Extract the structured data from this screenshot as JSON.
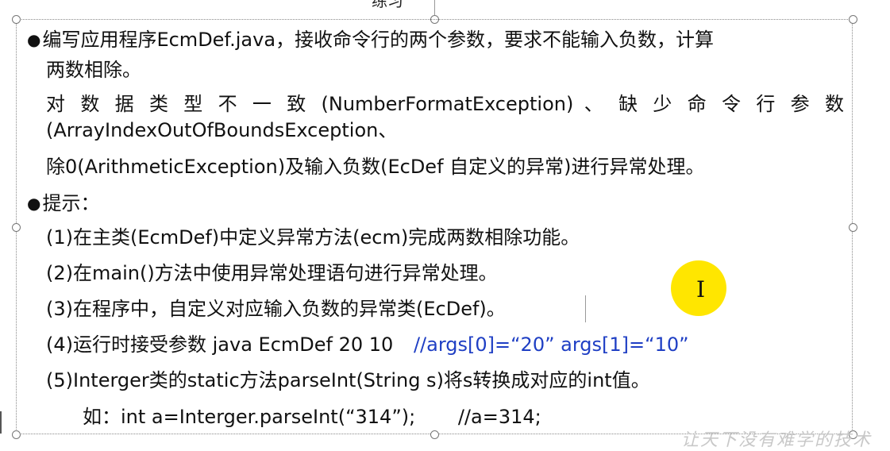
{
  "header": {
    "title_fragment": "练习"
  },
  "content": {
    "line1": "编写应用程序EcmDef.java，接收命令行的两个参数，要求不能输入负数，计算",
    "line2": "两数相除。",
    "line3": "对 数 据 类 型 不 一 致 (NumberFormatException) 、 缺 少 命 令 行 参 数",
    "line4": "(ArrayIndexOutOfBoundsException、",
    "line5": "除0(ArithmeticException)及输入负数(EcDef 自定义的异常)进行异常处理。",
    "hint_label": "提示：",
    "hint1": "(1)在主类(EcmDef)中定义异常方法(ecm)完成两数相除功能。",
    "hint2": "(2)在main()方法中使用异常处理语句进行异常处理。",
    "hint3": "(3)在程序中，自定义对应输入负数的异常类(EcDef)。",
    "hint4_text": "(4)运行时接受参数 java EcmDef 20 10",
    "hint4_comment": "//args[0]=“20” args[1]=“10”",
    "hint5": "(5)Interger类的static方法parseInt(String s)将s转换成对应的int值。",
    "example_code": "如：int a=Interger.parseInt(“314”);",
    "example_comment": "//a=314;"
  },
  "bullet_glyph": "●",
  "cursor_glyph": "I",
  "watermark": "让天下没有难学的技术",
  "colors": {
    "comment_blue": "#1f3fc4",
    "cursor_highlight": "#ffe600"
  }
}
